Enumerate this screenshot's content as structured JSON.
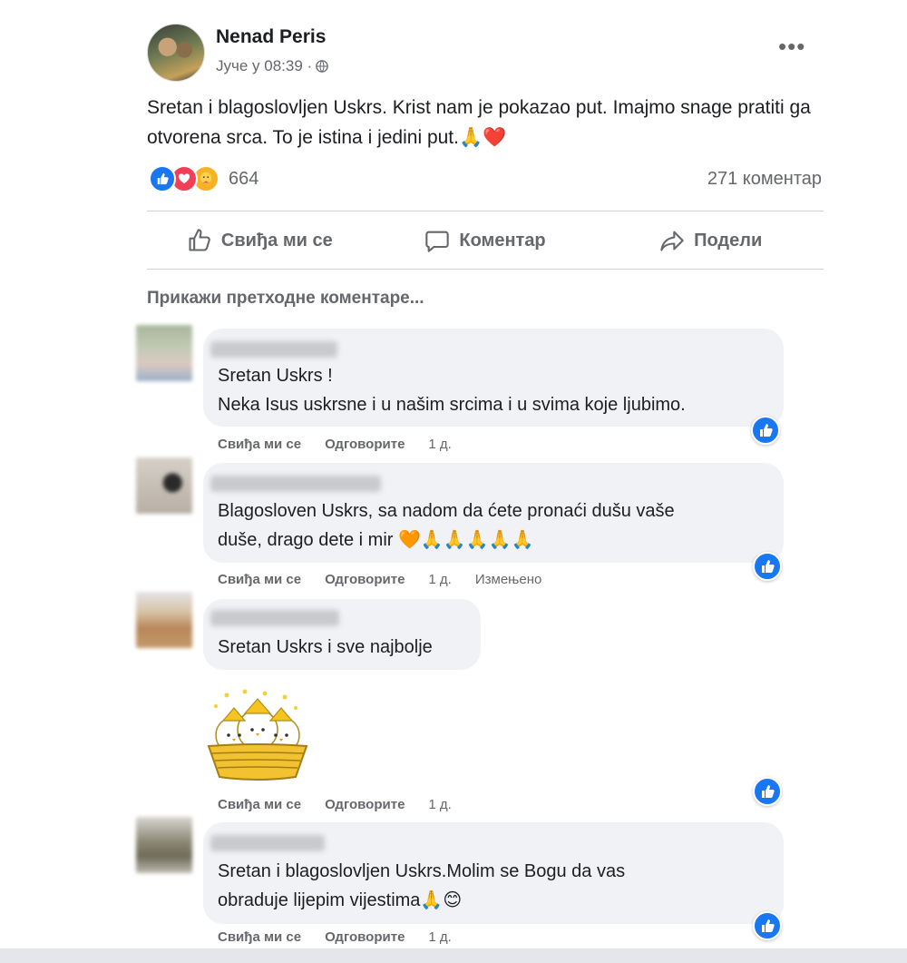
{
  "post": {
    "author": "Nenad Peris",
    "timestamp": "Јуче у 08:39 ·",
    "text": "Sretan i blagoslovljen Uskrs. Krist nam je pokazao put. Imajmo snage pratiti ga otvorena srca. To je istina i jedini put.🙏❤️",
    "reaction_count": "664",
    "comment_count": "271 коментар"
  },
  "actions": {
    "like": "Свиђа ми се",
    "comment": "Коментар",
    "share": "Подели"
  },
  "show_previous": "Прикажи претходне коментаре...",
  "comments": [
    {
      "line1": "Sretan Uskrs !",
      "line2": "Neka Isus uskrsne i u našim srcima i u svima koje ljubimo.",
      "like": "Свиђа ми се",
      "reply": "Одговорите",
      "time": "1 д."
    },
    {
      "line1": "Blagosloven Uskrs, sa nadom da ćete pronaći dušu vaše",
      "line2": "duše, drago dete i mir 🧡🙏🙏🙏🙏🙏",
      "like": "Свиђа ми се",
      "reply": "Одговорите",
      "time": "1 д.",
      "edited": "Измењено"
    },
    {
      "line1": "Sretan Uskrs i sve najbolje",
      "like": "Свиђа ми се",
      "reply": "Одговорите",
      "time": "1 д."
    },
    {
      "line1": "Sretan i blagoslovljen Uskrs.Molim se Bogu da vas",
      "line2": "obraduje lijepim vijestima🙏😊",
      "like": "Свиђа ми се",
      "reply": "Одговорите",
      "time": "1 д."
    }
  ],
  "colors": {
    "like_blue": "#1877f2",
    "love_red": "#f33e58",
    "care_yellow": "#f7b125",
    "bubble_bg": "#f0f2f5",
    "secondary_text": "#65676b"
  }
}
